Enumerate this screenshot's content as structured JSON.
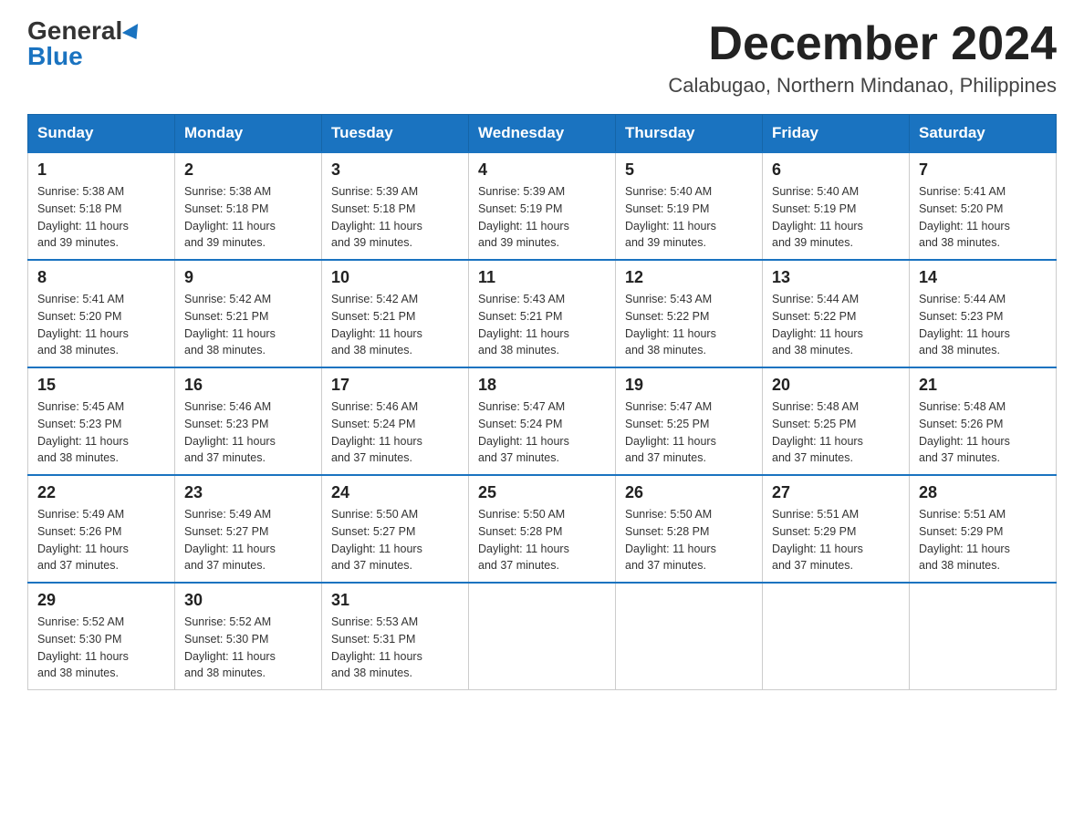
{
  "header": {
    "logo_general": "General",
    "logo_blue": "Blue",
    "month_title": "December 2024",
    "location": "Calabugao, Northern Mindanao, Philippines"
  },
  "days_of_week": [
    "Sunday",
    "Monday",
    "Tuesday",
    "Wednesday",
    "Thursday",
    "Friday",
    "Saturday"
  ],
  "weeks": [
    [
      {
        "day": "1",
        "sunrise": "5:38 AM",
        "sunset": "5:18 PM",
        "daylight": "11 hours and 39 minutes."
      },
      {
        "day": "2",
        "sunrise": "5:38 AM",
        "sunset": "5:18 PM",
        "daylight": "11 hours and 39 minutes."
      },
      {
        "day": "3",
        "sunrise": "5:39 AM",
        "sunset": "5:18 PM",
        "daylight": "11 hours and 39 minutes."
      },
      {
        "day": "4",
        "sunrise": "5:39 AM",
        "sunset": "5:19 PM",
        "daylight": "11 hours and 39 minutes."
      },
      {
        "day": "5",
        "sunrise": "5:40 AM",
        "sunset": "5:19 PM",
        "daylight": "11 hours and 39 minutes."
      },
      {
        "day": "6",
        "sunrise": "5:40 AM",
        "sunset": "5:19 PM",
        "daylight": "11 hours and 39 minutes."
      },
      {
        "day": "7",
        "sunrise": "5:41 AM",
        "sunset": "5:20 PM",
        "daylight": "11 hours and 38 minutes."
      }
    ],
    [
      {
        "day": "8",
        "sunrise": "5:41 AM",
        "sunset": "5:20 PM",
        "daylight": "11 hours and 38 minutes."
      },
      {
        "day": "9",
        "sunrise": "5:42 AM",
        "sunset": "5:21 PM",
        "daylight": "11 hours and 38 minutes."
      },
      {
        "day": "10",
        "sunrise": "5:42 AM",
        "sunset": "5:21 PM",
        "daylight": "11 hours and 38 minutes."
      },
      {
        "day": "11",
        "sunrise": "5:43 AM",
        "sunset": "5:21 PM",
        "daylight": "11 hours and 38 minutes."
      },
      {
        "day": "12",
        "sunrise": "5:43 AM",
        "sunset": "5:22 PM",
        "daylight": "11 hours and 38 minutes."
      },
      {
        "day": "13",
        "sunrise": "5:44 AM",
        "sunset": "5:22 PM",
        "daylight": "11 hours and 38 minutes."
      },
      {
        "day": "14",
        "sunrise": "5:44 AM",
        "sunset": "5:23 PM",
        "daylight": "11 hours and 38 minutes."
      }
    ],
    [
      {
        "day": "15",
        "sunrise": "5:45 AM",
        "sunset": "5:23 PM",
        "daylight": "11 hours and 38 minutes."
      },
      {
        "day": "16",
        "sunrise": "5:46 AM",
        "sunset": "5:23 PM",
        "daylight": "11 hours and 37 minutes."
      },
      {
        "day": "17",
        "sunrise": "5:46 AM",
        "sunset": "5:24 PM",
        "daylight": "11 hours and 37 minutes."
      },
      {
        "day": "18",
        "sunrise": "5:47 AM",
        "sunset": "5:24 PM",
        "daylight": "11 hours and 37 minutes."
      },
      {
        "day": "19",
        "sunrise": "5:47 AM",
        "sunset": "5:25 PM",
        "daylight": "11 hours and 37 minutes."
      },
      {
        "day": "20",
        "sunrise": "5:48 AM",
        "sunset": "5:25 PM",
        "daylight": "11 hours and 37 minutes."
      },
      {
        "day": "21",
        "sunrise": "5:48 AM",
        "sunset": "5:26 PM",
        "daylight": "11 hours and 37 minutes."
      }
    ],
    [
      {
        "day": "22",
        "sunrise": "5:49 AM",
        "sunset": "5:26 PM",
        "daylight": "11 hours and 37 minutes."
      },
      {
        "day": "23",
        "sunrise": "5:49 AM",
        "sunset": "5:27 PM",
        "daylight": "11 hours and 37 minutes."
      },
      {
        "day": "24",
        "sunrise": "5:50 AM",
        "sunset": "5:27 PM",
        "daylight": "11 hours and 37 minutes."
      },
      {
        "day": "25",
        "sunrise": "5:50 AM",
        "sunset": "5:28 PM",
        "daylight": "11 hours and 37 minutes."
      },
      {
        "day": "26",
        "sunrise": "5:50 AM",
        "sunset": "5:28 PM",
        "daylight": "11 hours and 37 minutes."
      },
      {
        "day": "27",
        "sunrise": "5:51 AM",
        "sunset": "5:29 PM",
        "daylight": "11 hours and 37 minutes."
      },
      {
        "day": "28",
        "sunrise": "5:51 AM",
        "sunset": "5:29 PM",
        "daylight": "11 hours and 38 minutes."
      }
    ],
    [
      {
        "day": "29",
        "sunrise": "5:52 AM",
        "sunset": "5:30 PM",
        "daylight": "11 hours and 38 minutes."
      },
      {
        "day": "30",
        "sunrise": "5:52 AM",
        "sunset": "5:30 PM",
        "daylight": "11 hours and 38 minutes."
      },
      {
        "day": "31",
        "sunrise": "5:53 AM",
        "sunset": "5:31 PM",
        "daylight": "11 hours and 38 minutes."
      },
      null,
      null,
      null,
      null
    ]
  ],
  "labels": {
    "sunrise": "Sunrise: ",
    "sunset": "Sunset: ",
    "daylight": "Daylight: "
  }
}
